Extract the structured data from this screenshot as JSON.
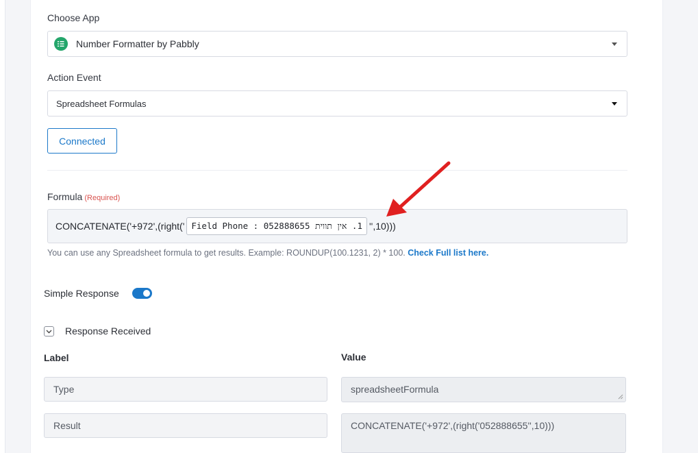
{
  "choose_app": {
    "label": "Choose App",
    "selected": "Number Formatter by Pabbly",
    "icon": "list-numbers-icon",
    "icon_color": "#24a66b"
  },
  "action_event": {
    "label": "Action Event",
    "selected": "Spreadsheet Formulas"
  },
  "connection": {
    "button_label": "Connected"
  },
  "formula": {
    "label": "Formula",
    "required_tag": "(Required)",
    "prefix": "CONCATENATE('+972',(right('",
    "token": "1. אין תווית Field Phone : 052888655",
    "suffix": "'',10)))",
    "hint_text": "You can use any Spreadsheet formula to get results. Example: ROUNDUP(100.1231, 2) * 100.",
    "hint_link": "Check Full list here."
  },
  "simple_response": {
    "label": "Simple Response",
    "enabled": true
  },
  "response_received": {
    "label": "Response Received",
    "column_label": "Label",
    "column_value": "Value",
    "rows": [
      {
        "label": "Type",
        "value": "spreadsheetFormula"
      },
      {
        "label": "Result",
        "value": "CONCATENATE('+972',(right('052888655'',10)))"
      }
    ]
  },
  "colors": {
    "accent": "#1b78c9",
    "annotation_arrow": "#e02020",
    "required": "#d9534f"
  }
}
